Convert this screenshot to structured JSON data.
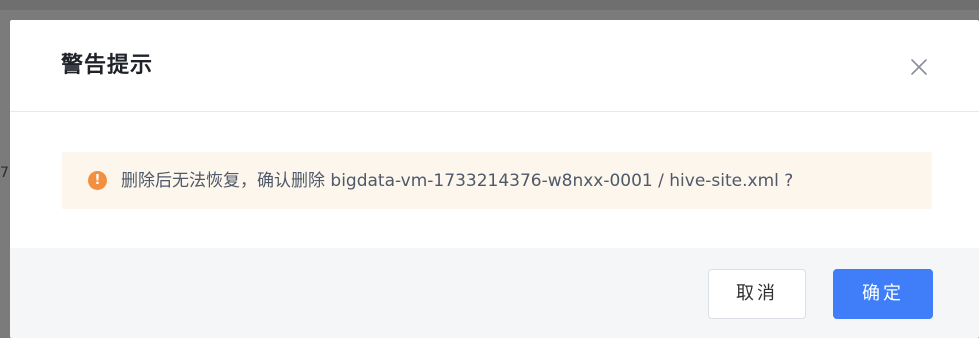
{
  "backdrop": {
    "edge_mark": "7"
  },
  "dialog": {
    "title": "警告提示",
    "close_icon": "close-icon",
    "alert": {
      "icon": "warning-icon",
      "icon_glyph": "!",
      "message": "删除后无法恢复，确认删除 bigdata-vm-1733214376-w8nxx-0001 / hive-site.xml ?"
    },
    "footer": {
      "cancel_label": "取消",
      "confirm_label": "确定"
    }
  },
  "colors": {
    "primary": "#3f7ef8",
    "warning": "#f3903f",
    "alert_background": "#fdf6ec",
    "footer_background": "#f5f6f8"
  }
}
